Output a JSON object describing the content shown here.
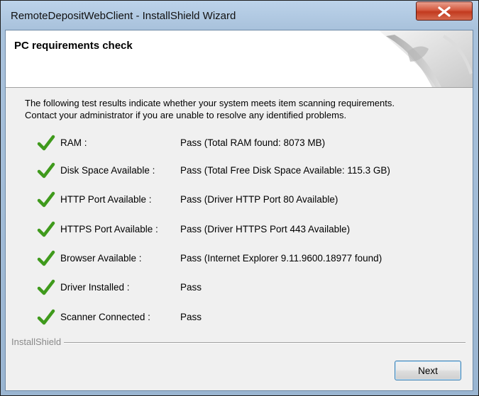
{
  "window": {
    "title": "RemoteDepositWebClient - InstallShield Wizard"
  },
  "header": {
    "title": "PC requirements check"
  },
  "intro": {
    "line1": "The following test results indicate whether your system meets item scanning requirements.",
    "line2": "Contact your administrator if you are unable to resolve any identified problems."
  },
  "checks": [
    {
      "label": "RAM :",
      "value": "Pass (Total RAM found: 8073 MB)",
      "status": "pass"
    },
    {
      "label": "Disk Space Available :",
      "value": "Pass (Total Free Disk Space Available: 115.3 GB)",
      "status": "pass"
    },
    {
      "label": "HTTP Port Available :",
      "value": "Pass (Driver HTTP Port 80 Available)",
      "status": "pass"
    },
    {
      "label": "HTTPS Port Available :",
      "value": "Pass (Driver HTTPS Port 443 Available)",
      "status": "pass"
    },
    {
      "label": "Browser Available :",
      "value": "Pass (Internet Explorer 9.11.9600.18977 found)",
      "status": "pass"
    },
    {
      "label": "Driver Installed :",
      "value": "Pass",
      "status": "pass"
    },
    {
      "label": "Scanner Connected :",
      "value": "Pass",
      "status": "pass"
    }
  ],
  "footer": {
    "brand": "InstallShield",
    "next_label": "Next"
  },
  "icons": {
    "check": "checkmark-icon",
    "close": "close-icon"
  },
  "colors": {
    "check_green": "#3f9a1c",
    "close_red": "#c9442a"
  }
}
